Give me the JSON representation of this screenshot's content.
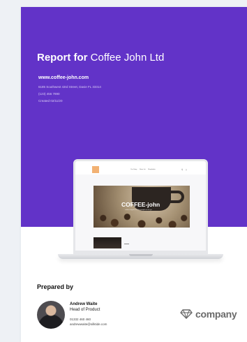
{
  "report": {
    "title_strong": "Report for",
    "title_light": "Coffee John Ltd",
    "website": "www.coffee-john.com",
    "address": "6185 Southwest 43rd Street, Davie FL 33314",
    "phone": "(123) 456 7890",
    "created": "Created 02/11/20"
  },
  "mockup": {
    "nav_items": [
      "Our Story",
      "Store list",
      "Shopfinder"
    ],
    "banner_title": "COFFEE-john",
    "banner_subtitle": "coffee magnet stuff for people on the go"
  },
  "prepared_by": {
    "heading": "Prepared by",
    "name": "Andrew Waite",
    "role": "Head of Product",
    "phone": "01332 460 460",
    "email": "andrewwaite@silktide.com"
  },
  "company": {
    "name": "company",
    "logo_icon": "diamond-icon"
  },
  "colors": {
    "hero_purple": "#6233c8",
    "text_dark": "#111111",
    "logo_gray": "#6a6a6a"
  }
}
